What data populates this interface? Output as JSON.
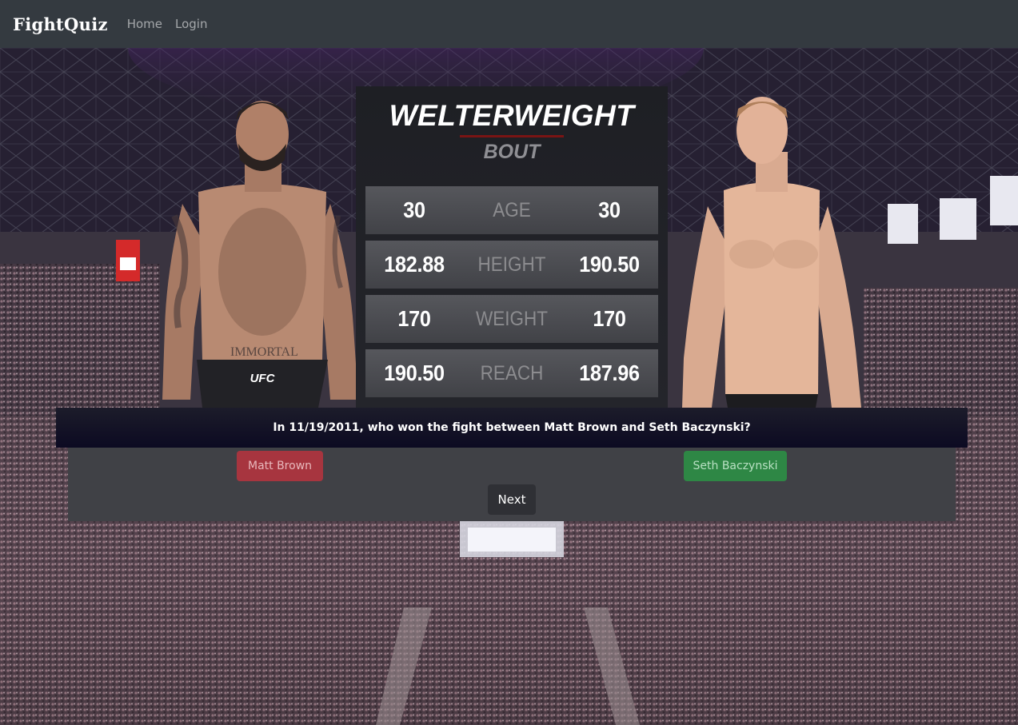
{
  "navbar": {
    "brand": "FightQuiz",
    "links": [
      "Home",
      "Login"
    ]
  },
  "bout": {
    "division": "WELTERWEIGHT",
    "subtitle": "BOUT",
    "stats": [
      {
        "label": "AGE",
        "left": "30",
        "right": "30"
      },
      {
        "label": "HEIGHT",
        "left": "182.88",
        "right": "190.50"
      },
      {
        "label": "WEIGHT",
        "left": "170",
        "right": "170"
      },
      {
        "label": "REACH",
        "left": "190.50",
        "right": "187.96"
      }
    ]
  },
  "fighters": {
    "left": {
      "name": "Matt Brown",
      "shorts_logo": "UFC",
      "tattoo_text": "IMMORTAL"
    },
    "right": {
      "name": "Seth Baczynski"
    }
  },
  "question": {
    "text": "In 11/19/2011, who won the fight between Matt Brown and Seth Baczynski?"
  },
  "answers": {
    "option_a": "Matt Brown",
    "option_b": "Seth Baczynski",
    "next": "Next"
  },
  "colors": {
    "navbar": "#343a40",
    "option_a": "#a7353f",
    "option_b": "#2e8745",
    "division_rule": "#7a1414"
  }
}
